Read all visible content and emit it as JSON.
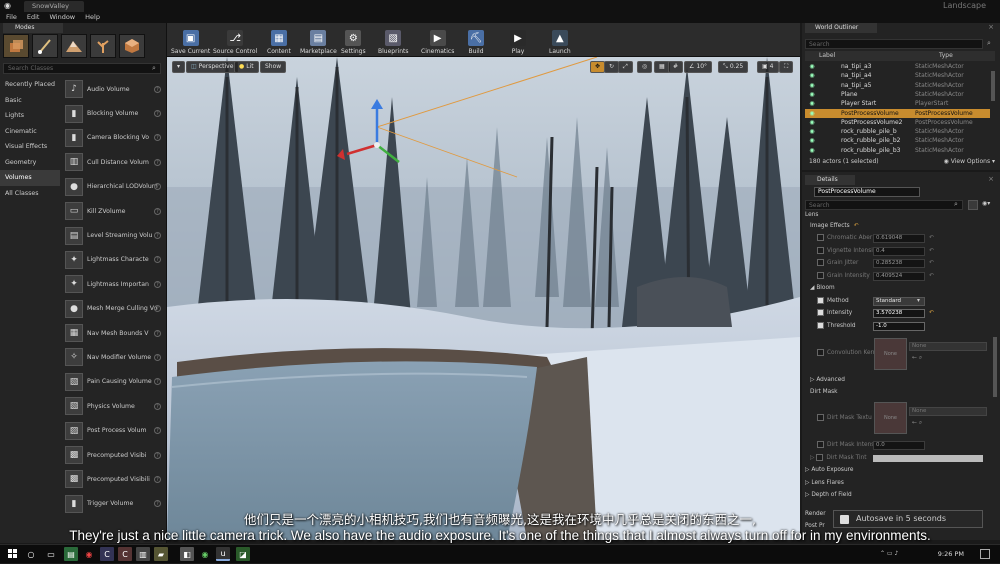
{
  "window": {
    "tab_title": "SnowValley",
    "project": "Landscape"
  },
  "menu": [
    "File",
    "Edit",
    "Window",
    "Help"
  ],
  "modes": {
    "tab_label": "Modes",
    "search_placeholder": "Search Classes",
    "categories": [
      "Recently Placed",
      "Basic",
      "Lights",
      "Cinematic",
      "Visual Effects",
      "Geometry",
      "Volumes",
      "All Classes"
    ],
    "active_category": "Volumes",
    "classes": [
      "Audio Volume",
      "Blocking Volume",
      "Camera Blocking Vo",
      "Cull Distance Volum",
      "Hierarchical LODVolume",
      "Kill ZVolume",
      "Level Streaming Volu",
      "Lightmass Characte",
      "Lightmass Importan",
      "Mesh Merge Culling Vol",
      "Nav Mesh Bounds V",
      "Nav Modifier Volume",
      "Pain Causing Volume",
      "Physics Volume",
      "Post Process Volum",
      "Precomputed Visibi",
      "Precomputed Visibili",
      "Trigger Volume"
    ]
  },
  "toolbar": {
    "buttons": [
      {
        "label": "Save Current",
        "icon": "save-icon",
        "color": "#4a6fa5"
      },
      {
        "label": "Source Control",
        "icon": "source-control-icon",
        "color": "#3a3a3a"
      },
      {
        "label": "Content",
        "icon": "content-icon",
        "color": "#4a6fa5"
      },
      {
        "label": "Marketplace",
        "icon": "marketplace-icon",
        "color": "#6a7fa0"
      },
      {
        "label": "Settings",
        "icon": "gear-icon",
        "color": "#555555"
      },
      {
        "label": "Blueprints",
        "icon": "blueprints-icon",
        "color": "#5a5a6a"
      },
      {
        "label": "Cinematics",
        "icon": "cinematics-icon",
        "color": "#4a4a4a"
      },
      {
        "label": "Build",
        "icon": "build-icon",
        "color": "#4a6fa5"
      },
      {
        "label": "Play",
        "icon": "play-icon",
        "color": "#2a2a2a"
      },
      {
        "label": "Launch",
        "icon": "launch-icon",
        "color": "#3a4a5a"
      }
    ]
  },
  "viewport": {
    "perspective_label": "Perspective",
    "lit_label": "Lit",
    "show_label": "Show",
    "angle_snap": "10°",
    "scale_snap": "0.25",
    "camera_speed": "4"
  },
  "outliner": {
    "tab_label": "World Outliner",
    "search_placeholder": "Search",
    "col_label": "Label",
    "col_type": "Type",
    "rows": [
      {
        "label": "na_tipi_a3",
        "type": "StaticMeshActor",
        "selected": false
      },
      {
        "label": "na_tipi_a4",
        "type": "StaticMeshActor",
        "selected": false
      },
      {
        "label": "na_tipi_a5",
        "type": "StaticMeshActor",
        "selected": false
      },
      {
        "label": "Plane",
        "type": "StaticMeshActor",
        "selected": false
      },
      {
        "label": "Player Start",
        "type": "PlayerStart",
        "selected": false
      },
      {
        "label": "PostProcessVolume",
        "type": "PostProcessVolume",
        "selected": true
      },
      {
        "label": "PostProcessVolume2",
        "type": "PostProcessVolume",
        "selected": false
      },
      {
        "label": "rock_rubble_pile_b",
        "type": "StaticMeshActor",
        "selected": false
      },
      {
        "label": "rock_rubble_pile_b2",
        "type": "StaticMeshActor",
        "selected": false
      },
      {
        "label": "rock_rubble_pile_b3",
        "type": "StaticMeshActor",
        "selected": false
      }
    ],
    "actor_count": "180 actors (1 selected)",
    "view_options": "View Options"
  },
  "details": {
    "tab_label": "Details",
    "object_name": "PostProcessVolume",
    "search_placeholder": "Search",
    "lens_label": "Lens",
    "image_effects_label": "Image Effects",
    "chromatic_label": "Chromatic Aber",
    "chromatic_value": "0.619048",
    "vignette_label": "Vignette Intensi",
    "vignette_value": "0.4",
    "grain_jitter_label": "Grain Jitter",
    "grain_jitter_value": "0.285238",
    "grain_intensity_label": "Grain Intensity",
    "grain_intensity_value": "0.409524",
    "bloom_label": "Bloom",
    "method_label": "Method",
    "method_value": "Standard",
    "intensity_label": "Intensity",
    "intensity_value": "3.570238",
    "threshold_label": "Threshold",
    "threshold_value": "-1.0",
    "convolution_label": "Convolution Kerr",
    "none_text": "None",
    "advanced_label": "Advanced",
    "dirt_mask_label": "Dirt Mask",
    "dirt_mask_texture_label": "Dirt Mask Textu",
    "dirt_mask_intensity_label": "Dirt Mask Intens",
    "dirt_mask_intensity_value": "0.0",
    "dirt_mask_tint_label": "Dirt Mask Tint",
    "auto_exposure_label": "Auto Exposure",
    "lens_flares_label": "Lens Flares",
    "dof_label": "Depth of Field",
    "rendering_label": "Render",
    "post_label": "Post Pr"
  },
  "subtitles": {
    "chinese": "他们只是一个漂亮的小相机技巧,我们也有音频曝光,这是我在环境中几乎总是关闭的东西之一,",
    "english": "They're just a nice little camera trick. We also have the audio exposure. It's one of the things that I almost always turn off for in my environments."
  },
  "toast": {
    "text": "Autosave in 5 seconds"
  },
  "taskbar": {
    "time": "9:26 PM"
  }
}
